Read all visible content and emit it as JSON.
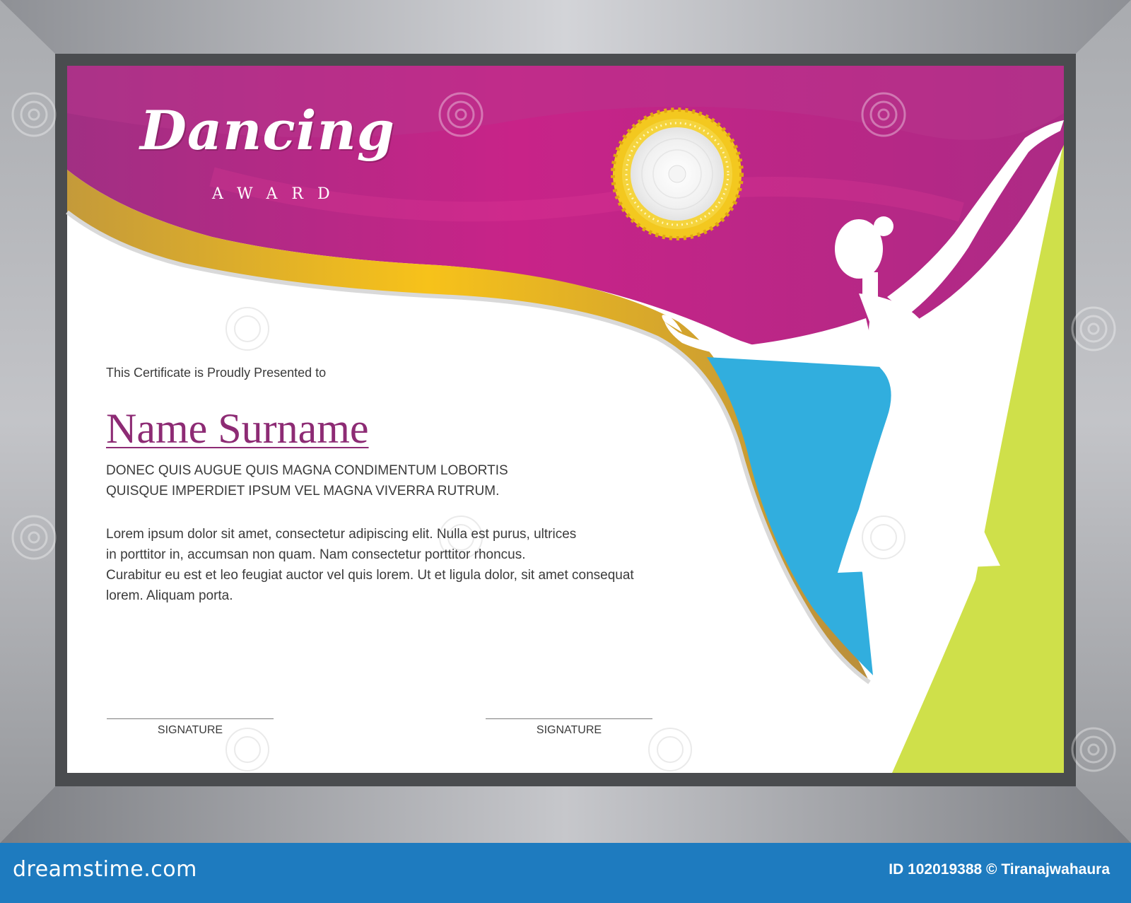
{
  "certificate": {
    "title_script": "Dancing",
    "title_award": "AWARD",
    "presented_to": "This Certificate is Proudly Presented to",
    "recipient_name": "Name Surname",
    "caps_lines": [
      "DONEC QUIS AUGUE QUIS MAGNA  CONDIMENTUM LOBORTIS",
      "QUISQUE IMPERDIET IPSUM VEL MAGNA VIVERRA RUTRUM."
    ],
    "body_lines": [
      "Lorem ipsum dolor sit amet, consectetur adipiscing elit.  Nulla est purus,  ultrices",
      "in porttitor in, accumsan non quam. Nam consectetur porttitor rhoncus.",
      "Curabitur eu est et leo  feugiat auctor vel quis lorem. Ut et  ligula dolor,  sit amet consequat",
      "lorem. Aliquam porta."
    ],
    "signatures": [
      "SIGNATURE",
      "SIGNATURE"
    ]
  },
  "watermark": {
    "logo": "dreamstime.com",
    "credit": "ID 102019388 © Tiranajwahaura"
  },
  "colors": {
    "frame_silver": "#b5b6ba",
    "frame_border": "#4a4c4f",
    "magenta": "#b02a86",
    "gold": "#e8b92a",
    "cyan": "#31aede",
    "lime": "#cfe04a",
    "name_purple": "#8d2b74",
    "footer_blue": "#1e7bbf"
  },
  "icons": {
    "seal": "gold-rosette-seal-icon",
    "dancer": "dancer-silhouette-icon"
  }
}
